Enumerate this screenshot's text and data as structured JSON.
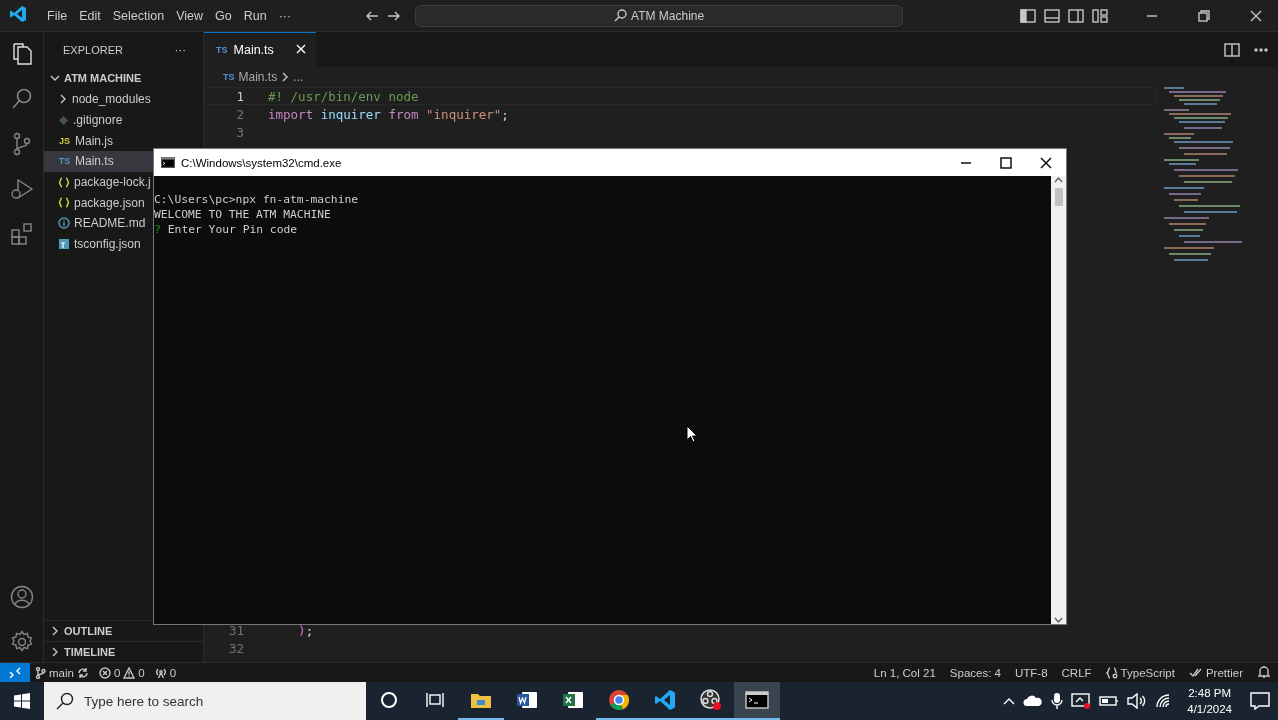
{
  "titlebar": {
    "menus": [
      "File",
      "Edit",
      "Selection",
      "View",
      "Go",
      "Run",
      "···"
    ],
    "search": "ATM Machine"
  },
  "explorer": {
    "title": "EXPLORER",
    "more": "···",
    "project": "ATM MACHINE",
    "files": [
      {
        "name": "node_modules",
        "kind": "folder",
        "selected": false
      },
      {
        "name": ".gitignore",
        "kind": "git",
        "selected": false
      },
      {
        "name": "Main.js",
        "kind": "js",
        "icon_text": "JS",
        "selected": false
      },
      {
        "name": "Main.ts",
        "kind": "ts",
        "icon_text": "TS",
        "selected": true
      },
      {
        "name": "package-lock.j",
        "kind": "json",
        "selected": false
      },
      {
        "name": "package.json",
        "kind": "json",
        "selected": false
      },
      {
        "name": "README.md",
        "kind": "info",
        "selected": false
      },
      {
        "name": "tsconfig.json",
        "kind": "tsconfig",
        "selected": false
      }
    ],
    "sections": [
      "OUTLINE",
      "TIMELINE"
    ]
  },
  "editor": {
    "tabs": [
      {
        "icon_text": "TS",
        "label": "Main.ts",
        "selected": true
      }
    ],
    "breadcrumb": {
      "icon_text": "TS",
      "file": "Main.ts",
      "rest": "..."
    },
    "top_lines": [
      {
        "number": "1",
        "current": true,
        "tokens": [
          {
            "kind": "comment",
            "text": "#! /usr/bin/env node"
          }
        ]
      },
      {
        "number": "2",
        "current": false,
        "tokens": [
          {
            "kind": "keyword",
            "text": "import "
          },
          {
            "kind": "variable",
            "text": "inquirer "
          },
          {
            "kind": "keyword",
            "text": "from "
          },
          {
            "kind": "string",
            "text": "\"inquirer\""
          },
          {
            "kind": "plain",
            "text": ";"
          }
        ]
      },
      {
        "number": "3",
        "current": false
      }
    ],
    "bottom_lines": [
      {
        "number": "31",
        "current": false,
        "tokens": [
          {
            "kind": "bracket",
            "text": "    )"
          },
          {
            "kind": "plain",
            "text": ";"
          }
        ]
      },
      {
        "number": "32",
        "current": false
      }
    ]
  },
  "cmd": {
    "title": "C:\\Windows\\system32\\cmd.exe",
    "lines": [
      {
        "text": "C:\\Users\\pc>npx fn-atm-machine"
      },
      {
        "text": "WELCOME TO THE ATM MACHINE"
      },
      {
        "prompt": "?",
        "text": "Enter Your Pin code"
      }
    ]
  },
  "status_bar": {
    "branch": "main",
    "errors": "0",
    "warnings": "0",
    "ports": "0",
    "right": [
      {
        "kind": "text",
        "text": "Ln 1, Col 21"
      },
      {
        "kind": "text",
        "text": "Spaces: 4"
      },
      {
        "kind": "text",
        "text": "UTF-8"
      },
      {
        "kind": "text",
        "text": "CRLF"
      },
      {
        "kind": "language",
        "text": "TypeScript"
      },
      {
        "kind": "prettier",
        "text": "Prettier"
      }
    ]
  },
  "taskbar": {
    "search": {
      "placeholder": "Type here to search"
    },
    "apps": [
      {
        "kind": "cortana",
        "running": false,
        "selected": false
      },
      {
        "kind": "taskview",
        "running": false,
        "selected": false
      },
      {
        "kind": "explorer",
        "running": true,
        "selected": false
      },
      {
        "kind": "word",
        "running": false,
        "selected": false
      },
      {
        "kind": "excel",
        "running": false,
        "selected": false
      },
      {
        "kind": "chrome",
        "running": true,
        "selected": false
      },
      {
        "kind": "vscode",
        "running": true,
        "selected": false
      },
      {
        "kind": "obs",
        "running": true,
        "selected": false
      },
      {
        "kind": "cmd",
        "running": true,
        "selected": true
      }
    ],
    "time": "2:48 PM",
    "date": "4/1/2024"
  }
}
